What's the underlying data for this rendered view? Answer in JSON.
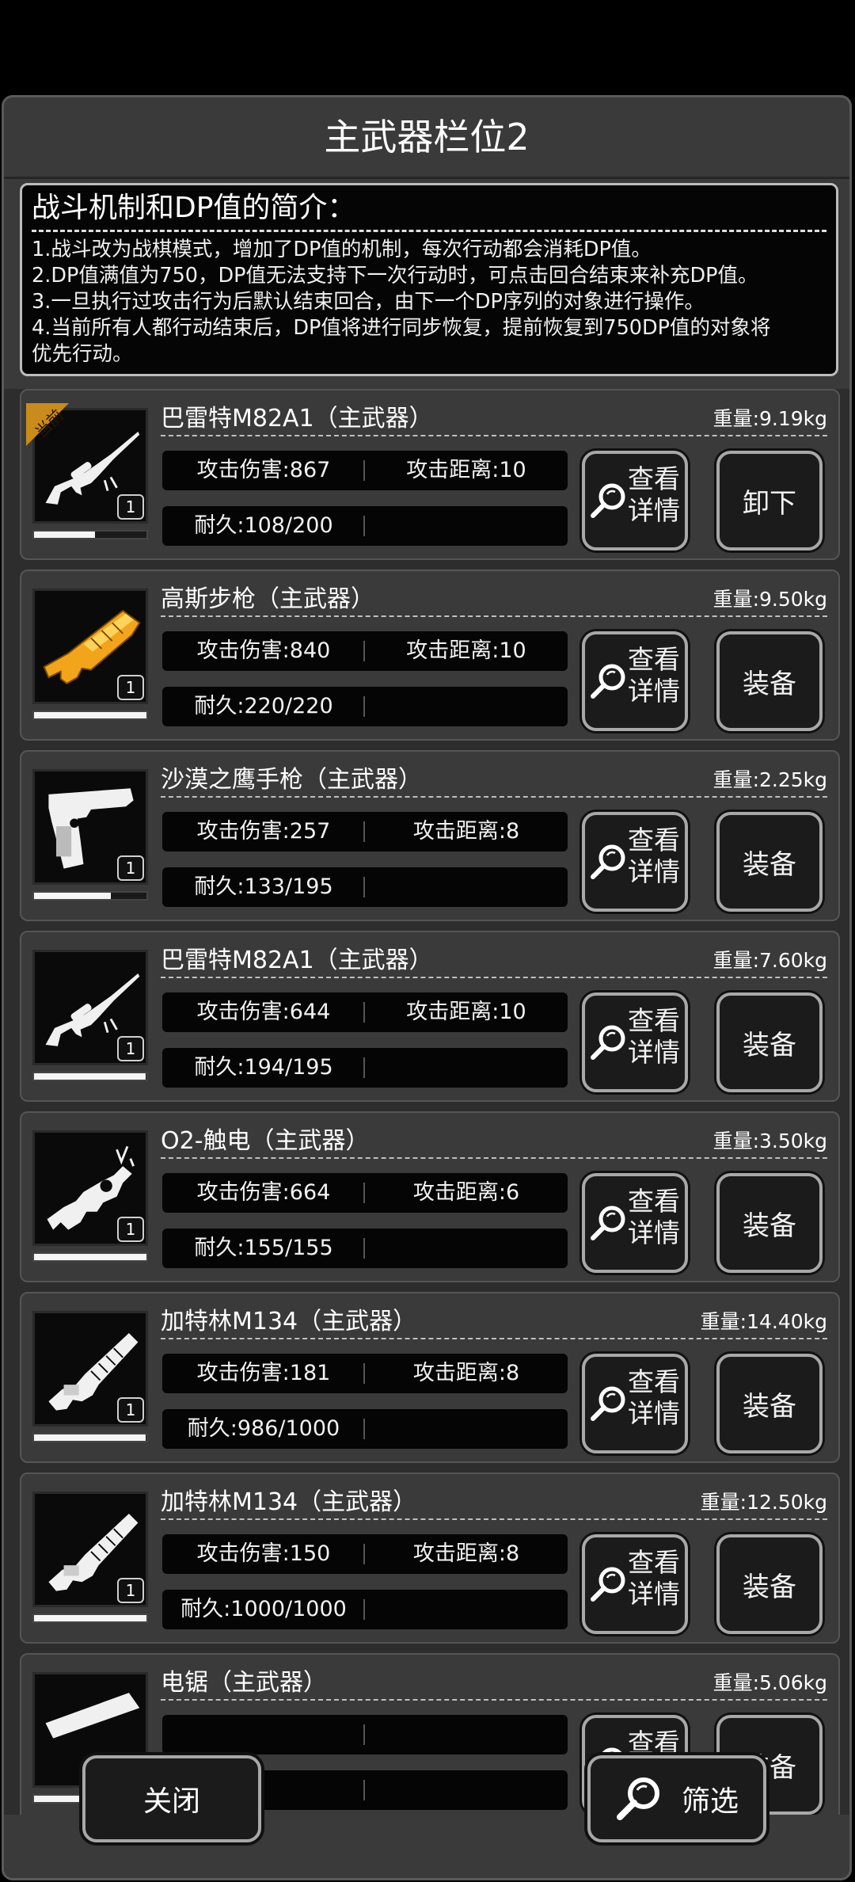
{
  "title": "主武器栏位2",
  "intro": {
    "title": "战斗机制和DP值的简介：",
    "lines": [
      "1.战斗改为战棋模式，增加了DP值的机制，每次行动都会消耗DP值。",
      "2.DP值满值为750，DP值无法支持下一次行动时，可点击回合结束来补充DP值。",
      "3.一旦执行过攻击行为后默认结束回合，由下一个DP序列的对象进行操作。",
      "4.当前所有人都行动结束后，DP值将进行同步恢复，提前恢复到750DP值的对象将\n优先行动。"
    ]
  },
  "buttons": {
    "detail": "查看详情",
    "detail_line1": "查看",
    "detail_line2": "详情",
    "unequip": "卸下",
    "equip": "装备"
  },
  "current_badge": "当前",
  "items": [
    {
      "name": "巴雷特M82A1（主武器）",
      "weight": "重量:9.19kg",
      "attack": "攻击伤害:867",
      "range": "攻击距离:10",
      "durability": "耐久:108/200",
      "durability_fraction": 0.54,
      "count": "1",
      "action": "卸下",
      "icon": "sniper-rifle-icon",
      "current": true
    },
    {
      "name": "高斯步枪（主武器）",
      "weight": "重量:9.50kg",
      "attack": "攻击伤害:840",
      "range": "攻击距离:10",
      "durability": "耐久:220/220",
      "durability_fraction": 1.0,
      "count": "1",
      "action": "装备",
      "icon": "gauss-rifle-icon",
      "current": false
    },
    {
      "name": "沙漠之鹰手枪（主武器）",
      "weight": "重量:2.25kg",
      "attack": "攻击伤害:257",
      "range": "攻击距离:8",
      "durability": "耐久:133/195",
      "durability_fraction": 0.68,
      "count": "1",
      "action": "装备",
      "icon": "pistol-icon",
      "current": false
    },
    {
      "name": "巴雷特M82A1（主武器）",
      "weight": "重量:7.60kg",
      "attack": "攻击伤害:644",
      "range": "攻击距离:10",
      "durability": "耐久:194/195",
      "durability_fraction": 0.99,
      "count": "1",
      "action": "装备",
      "icon": "sniper-rifle-icon",
      "current": false
    },
    {
      "name": "O2-触电（主武器）",
      "weight": "重量:3.50kg",
      "attack": "攻击伤害:664",
      "range": "攻击距离:6",
      "durability": "耐久:155/155",
      "durability_fraction": 1.0,
      "count": "1",
      "action": "装备",
      "icon": "electric-gun-icon",
      "current": false
    },
    {
      "name": "加特林M134（主武器）",
      "weight": "重量:14.40kg",
      "attack": "攻击伤害:181",
      "range": "攻击距离:8",
      "durability": "耐久:986/1000",
      "durability_fraction": 0.99,
      "count": "1",
      "action": "装备",
      "icon": "gatling-gun-icon",
      "current": false
    },
    {
      "name": "加特林M134（主武器）",
      "weight": "重量:12.50kg",
      "attack": "攻击伤害:150",
      "range": "攻击距离:8",
      "durability": "耐久:1000/1000",
      "durability_fraction": 1.0,
      "count": "1",
      "action": "装备",
      "icon": "gatling-gun-icon",
      "current": false
    },
    {
      "name": "电锯（主武器）",
      "weight": "重量:5.06kg",
      "attack": "",
      "range": "",
      "durability": "",
      "durability_fraction": 1.0,
      "count": "",
      "action": "装备",
      "icon": "chainsaw-icon",
      "current": false
    }
  ],
  "footer": {
    "close": "关闭",
    "filter": "筛选"
  }
}
